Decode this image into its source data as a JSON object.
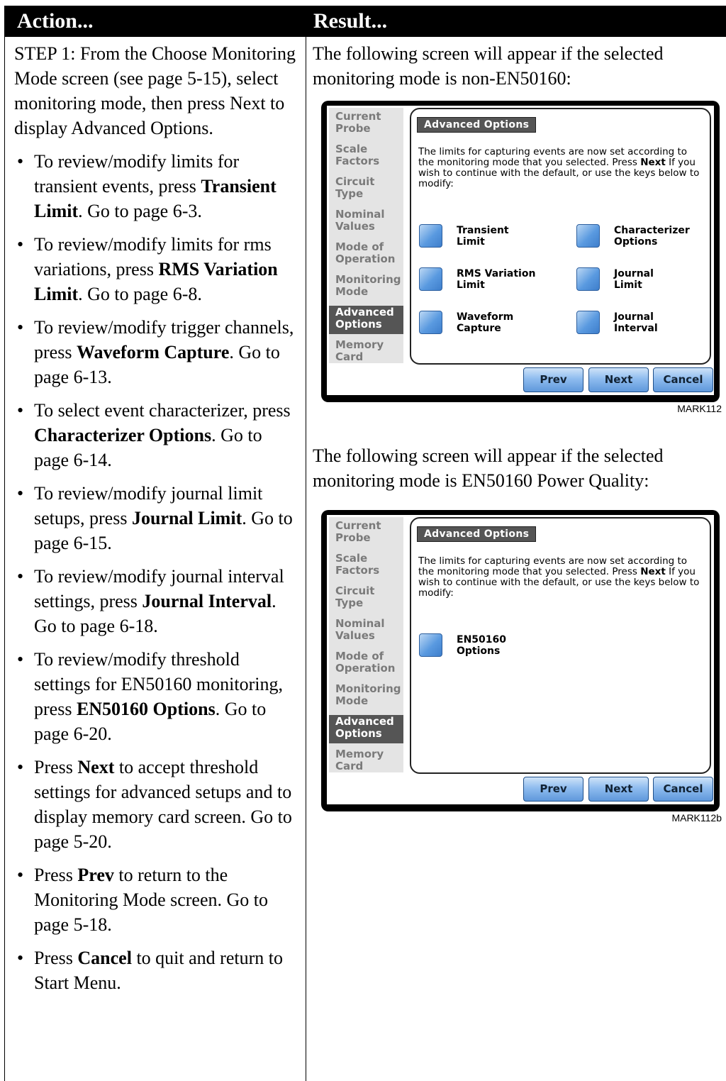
{
  "header": {
    "action": "Action...",
    "result": "Result..."
  },
  "left": {
    "step": "STEP 1: From the Choose Monitoring Mode screen (see page 5-15), select monitoring mode, then press Next to display Advanced Options.",
    "bullets": [
      {
        "pre": "To review/modify limits for transient events, press ",
        "bold": "Transient Limit",
        "post": ". Go to page 6-3."
      },
      {
        "pre": "To review/modify limits for rms variations, press ",
        "bold": "RMS Variation Limit",
        "post": ". Go to page 6-8."
      },
      {
        "pre": "To review/modify trigger channels, press ",
        "bold": "Waveform Capture",
        "post": ". Go to page 6-13."
      },
      {
        "pre": "To select event characterizer, press ",
        "bold": "Characterizer Options",
        "post": ". Go to page 6-14."
      },
      {
        "pre": "To review/modify journal limit setups, press ",
        "bold": "Journal Limit",
        "post": ". Go to page 6-15."
      },
      {
        "pre": "To review/modify journal interval settings, press ",
        "bold": "Journal Interval",
        "post": ". Go to page 6-18."
      },
      {
        "pre": "To review/modify threshold settings for EN50160 monitoring, press ",
        "bold": "EN50160 Options",
        "post": ". Go to page 6-20."
      },
      {
        "pre": "Press ",
        "bold": "Next",
        "post": " to accept threshold settings for advanced setups and to display memory card screen. Go to page 5-20."
      },
      {
        "pre": "Press ",
        "bold": "Prev",
        "post": " to return to the Monitoring Mode screen. Go to page 5-18."
      },
      {
        "pre": "Press ",
        "bold": "Cancel",
        "post": " to quit and return to Start Menu."
      }
    ]
  },
  "right": {
    "intro1": "The following screen will appear if the selected monitoring mode is non-EN50160:",
    "intro2": "The following screen will appear if the selected monitoring mode is EN50160 Power Quality:",
    "caption1": "MARK112",
    "caption2": "MARK112b"
  },
  "screen": {
    "sidebar": [
      "Current Probe",
      "Scale Factors",
      "Circuit Type",
      "Nominal Values",
      "Mode of Operation",
      "Monitoring Mode",
      "Advanced Options",
      "Memory Card"
    ],
    "title": "Advanced Options",
    "text_pre": "The limits for capturing events are now set according to the monitoring mode that you selected. Press ",
    "text_bold": "Next",
    "text_post": " If you wish to continue with the default, or use the keys below to modify:",
    "options1": [
      "Transient Limit",
      "Characterizer Options",
      "RMS Variation Limit",
      "Journal Limit",
      "Waveform Capture",
      "Journal Interval"
    ],
    "options2": [
      "EN50160 Options"
    ],
    "buttons": {
      "prev": "Prev",
      "next": "Next",
      "cancel": "Cancel"
    }
  }
}
